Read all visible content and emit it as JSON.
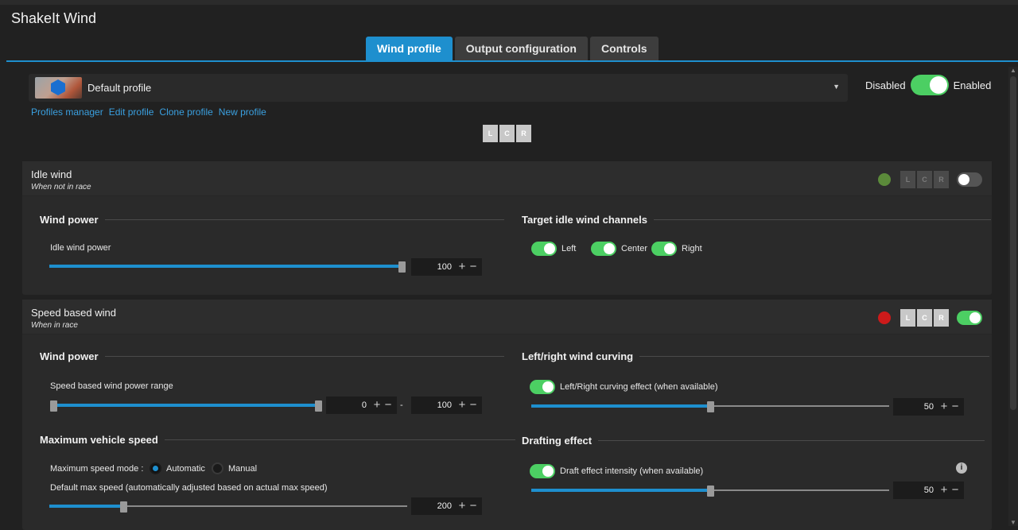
{
  "app": {
    "title": "ShakeIt Wind"
  },
  "tabs": [
    {
      "label": "Wind profile",
      "active": true
    },
    {
      "label": "Output configuration",
      "active": false
    },
    {
      "label": "Controls",
      "active": false
    }
  ],
  "profile": {
    "selected": "Default profile",
    "links": [
      "Profiles manager",
      "Edit profile",
      "Clone profile",
      "New profile"
    ],
    "enable": {
      "off_label": "Disabled",
      "on_label": "Enabled",
      "enabled": true
    },
    "channels": [
      "L",
      "C",
      "R"
    ]
  },
  "idle_wind": {
    "title": "Idle wind",
    "subtitle": "When not in race",
    "status_color": "#5b8a3a",
    "enabled": false,
    "wind_power": {
      "section": "Wind power",
      "label": "Idle wind power",
      "value": "100",
      "fraction": 1.0
    },
    "targets": {
      "section": "Target idle wind channels",
      "channels": [
        {
          "label": "Left",
          "on": true
        },
        {
          "label": "Center",
          "on": true
        },
        {
          "label": "Right",
          "on": true
        }
      ]
    }
  },
  "speed_wind": {
    "title": "Speed based wind",
    "subtitle": "When in race",
    "status_color": "#cc1a1a",
    "enabled": true,
    "wind_power": {
      "section": "Wind power",
      "label": "Speed based wind power range",
      "min_value": "0",
      "max_value": "100",
      "separator": "-"
    },
    "max_speed": {
      "section": "Maximum vehicle speed",
      "mode_label": "Maximum speed mode :",
      "modes": [
        {
          "label": "Automatic",
          "selected": true
        },
        {
          "label": "Manual",
          "selected": false
        }
      ],
      "default_label": "Default max speed (automatically adjusted based on actual max speed)",
      "value": "200",
      "fraction": 0.2
    },
    "curving": {
      "section": "Left/right wind curving",
      "label": "Left/Right curving effect (when available)",
      "on": true,
      "value": "50",
      "fraction": 0.5
    },
    "drafting": {
      "section": "Drafting effect",
      "label": "Draft effect intensity (when available)",
      "on": true,
      "value": "50",
      "fraction": 0.5
    }
  },
  "icons": {
    "info": "i",
    "plus": "+",
    "minus": "−",
    "caret": "▼",
    "scroll_up": "▲",
    "scroll_down": "▼"
  }
}
